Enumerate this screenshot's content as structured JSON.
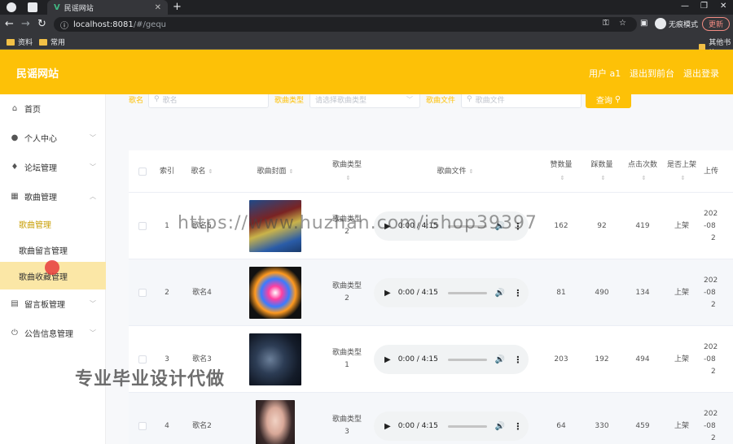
{
  "browser": {
    "tab_title": "民谣网站",
    "url_host": "localhost:8081",
    "url_path": "/#/gequ",
    "incognito_label": "无痕模式",
    "update_label": "更新",
    "bookmarks": [
      "资料",
      "常用"
    ],
    "other_bookmarks": "其他书签"
  },
  "header": {
    "site_title": "民谣网站",
    "user_label": "用户 a1",
    "back_label": "退出到前台",
    "logout_label": "退出登录"
  },
  "sidebar": {
    "items": [
      {
        "label": "首页",
        "icon": "home-icon"
      },
      {
        "label": "个人中心",
        "icon": "user-icon"
      },
      {
        "label": "论坛管理",
        "icon": "pin-icon"
      },
      {
        "label": "歌曲管理",
        "icon": "grid-icon"
      },
      {
        "label": "留言板管理",
        "icon": "clipboard-icon"
      },
      {
        "label": "公告信息管理",
        "icon": "power-icon"
      }
    ],
    "subitems": [
      "歌曲管理",
      "歌曲留言管理",
      "歌曲收藏管理"
    ]
  },
  "filters": {
    "name_label": "歌名",
    "name_placeholder": "歌名",
    "type_label": "歌曲类型",
    "type_placeholder": "请选择歌曲类型",
    "file_label": "歌曲文件",
    "file_placeholder": "歌曲文件",
    "search_label": "查询"
  },
  "table": {
    "columns": [
      "索引",
      "歌名",
      "歌曲封面",
      "歌曲类型",
      "歌曲文件",
      "赞数量",
      "踩数量",
      "点击次数",
      "是否上架",
      "上传"
    ],
    "rows": [
      {
        "index": "1",
        "name": "歌名5",
        "type": "歌曲类型",
        "type_num": "2",
        "time": "0:00 / 4:15",
        "likes": "162",
        "dislikes": "92",
        "clicks": "419",
        "status": "上架",
        "date1": "202",
        "date2": "-08",
        "date3": "2"
      },
      {
        "index": "2",
        "name": "歌名4",
        "type": "歌曲类型",
        "type_num": "2",
        "time": "0:00 / 4:15",
        "likes": "81",
        "dislikes": "490",
        "clicks": "134",
        "status": "上架",
        "date1": "202",
        "date2": "-08",
        "date3": "2"
      },
      {
        "index": "3",
        "name": "歌名3",
        "type": "歌曲类型",
        "type_num": "1",
        "time": "0:00 / 4:15",
        "likes": "203",
        "dislikes": "192",
        "clicks": "494",
        "status": "上架",
        "date1": "202",
        "date2": "-08",
        "date3": "2"
      },
      {
        "index": "4",
        "name": "歌名2",
        "type": "歌曲类型",
        "type_num": "3",
        "time": "0:00 / 4:15",
        "likes": "64",
        "dislikes": "330",
        "clicks": "459",
        "status": "上架",
        "date1": "202",
        "date2": "-08",
        "date3": "2"
      }
    ]
  },
  "overlay": {
    "watermark_url": "https://www.huzhan.com/ishop39397",
    "promo_text": "专业毕业设计代做"
  },
  "colors": {
    "brand": "#fdc107",
    "sidebar_hover": "#fbe7a6"
  }
}
